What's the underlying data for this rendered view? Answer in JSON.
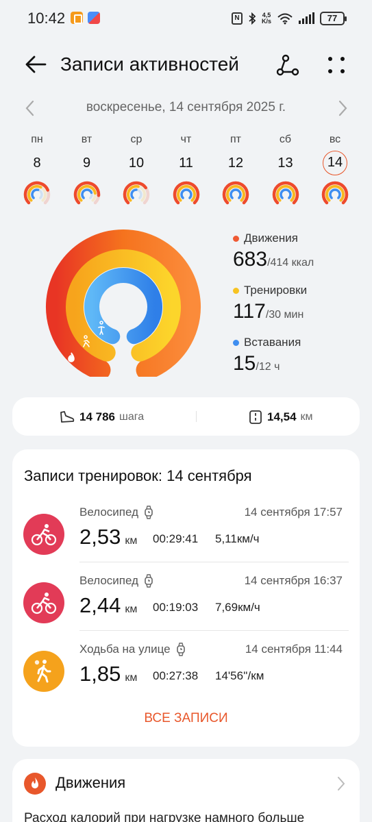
{
  "status_bar": {
    "time": "10:42",
    "speed_value": "4,5",
    "speed_unit": "K/s",
    "battery": "77"
  },
  "header": {
    "title": "Записи активностей"
  },
  "date_nav": {
    "date_text": "воскресенье, 14 сентября 2025 г."
  },
  "week": [
    {
      "name": "пн",
      "num": "8",
      "selected": false,
      "move": 0.75,
      "exercise": 0.6,
      "stand": 0.55
    },
    {
      "name": "вт",
      "num": "9",
      "selected": false,
      "move": 0.85,
      "exercise": 0.8,
      "stand": 0.75
    },
    {
      "name": "ср",
      "num": "10",
      "selected": false,
      "move": 0.7,
      "exercise": 0.55,
      "stand": 0.5
    },
    {
      "name": "чт",
      "num": "11",
      "selected": false,
      "move": 1,
      "exercise": 1,
      "stand": 1
    },
    {
      "name": "пт",
      "num": "12",
      "selected": false,
      "move": 1,
      "exercise": 1,
      "stand": 1
    },
    {
      "name": "сб",
      "num": "13",
      "selected": false,
      "move": 1,
      "exercise": 1,
      "stand": 1
    },
    {
      "name": "вс",
      "num": "14",
      "selected": true,
      "move": 1,
      "exercise": 1,
      "stand": 1
    }
  ],
  "metrics": {
    "movement": {
      "label": "Движения",
      "value": "683",
      "goal": "/414 ккал",
      "color": "#ef5a34"
    },
    "workouts": {
      "label": "Тренировки",
      "value": "117",
      "goal": "/30 мин",
      "color": "#f7c322"
    },
    "standing": {
      "label": "Вставания",
      "value": "15",
      "goal": "/12 ч",
      "color": "#3f8ef0"
    }
  },
  "steps": {
    "steps_value": "14 786",
    "steps_unit": "шага",
    "distance_value": "14,54",
    "distance_unit": "км"
  },
  "workouts_card": {
    "title": "Записи тренировок: 14 сентября",
    "items": [
      {
        "name": "Велосипед",
        "datetime": "14 сентября 17:57",
        "distance": "2,53",
        "unit": "км",
        "duration": "00:29:41",
        "speed": "5,11км/ч",
        "icon": "cycling-icon",
        "color": "#e23b57"
      },
      {
        "name": "Велосипед",
        "datetime": "14 сентября 16:37",
        "distance": "2,44",
        "unit": "км",
        "duration": "00:19:03",
        "speed": "7,69км/ч",
        "icon": "cycling-icon",
        "color": "#e23b57"
      },
      {
        "name": "Ходьба на улице",
        "datetime": "14 сентября 11:44",
        "distance": "1,85",
        "unit": "км",
        "duration": "00:27:38",
        "speed": "14'56''/км",
        "icon": "walking-icon",
        "color": "#f5a21c"
      }
    ],
    "all_records": "ВСЕ ЗАПИСИ"
  },
  "movement_card": {
    "title": "Движения",
    "text": "Расход калорий при нагрузке намного больше"
  }
}
